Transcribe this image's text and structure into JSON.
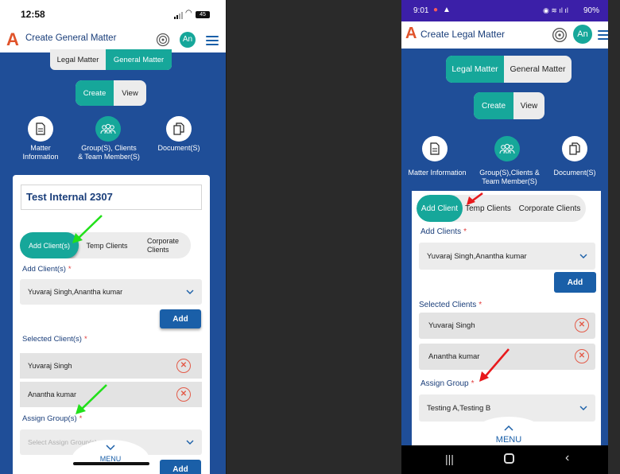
{
  "left": {
    "status": {
      "time": "12:58",
      "battery": "45"
    },
    "header": {
      "title": "Create General Matter",
      "avatar": "An"
    },
    "matter_tabs": [
      {
        "label": "Legal Matter",
        "active": false
      },
      {
        "label": "General Matter",
        "active": true
      }
    ],
    "mode_tabs": [
      {
        "label": "Create",
        "active": true
      },
      {
        "label": "View",
        "active": false
      }
    ],
    "steps": [
      {
        "label": "Matter\nInformation",
        "icon": "document-icon"
      },
      {
        "label": "Group(S), Clients\n& Team Member(S)",
        "icon": "group-icon"
      },
      {
        "label": "Document(S)",
        "icon": "copy-icon"
      }
    ],
    "matter_name": "Test Internal 2307",
    "client_tabs": [
      {
        "label": "Add Client(s)",
        "active": true
      },
      {
        "label": "Temp Clients",
        "active": false
      },
      {
        "label": "Corporate\nClients",
        "active": false
      }
    ],
    "add_clients_label": "Add Client(s)",
    "add_clients_value": "Yuvaraj Singh,Anantha kumar",
    "add_button": "Add",
    "selected_label": "Selected Client(s)",
    "selected_clients": [
      "Yuvaraj Singh",
      "Anantha kumar"
    ],
    "assign_label": "Assign Group(s)",
    "assign_placeholder": "Select Assign Group(s)",
    "add_button_2": "Add",
    "menu_label": "MENU",
    "required_star": "*"
  },
  "right": {
    "status": {
      "time": "9:01",
      "battery": "90%"
    },
    "header": {
      "title": "Create Legal Matter",
      "avatar": "An"
    },
    "matter_tabs": [
      {
        "label": "Legal Matter",
        "active": true
      },
      {
        "label": "General Matter",
        "active": false
      }
    ],
    "mode_tabs": [
      {
        "label": "Create",
        "active": true
      },
      {
        "label": "View",
        "active": false
      }
    ],
    "steps": [
      {
        "label": "Matter Information",
        "icon": "document-icon"
      },
      {
        "label": "Group(S),Clients &\nTeam Member(S)",
        "icon": "group-icon"
      },
      {
        "label": "Document(S)",
        "icon": "copy-icon"
      }
    ],
    "client_tabs": [
      {
        "label": "Add Client",
        "active": true
      },
      {
        "label": "Temp Clients",
        "active": false
      },
      {
        "label": "Corporate Clients",
        "active": false
      }
    ],
    "add_clients_label": "Add Clients",
    "add_clients_value": "Yuvaraj Singh,Anantha kumar",
    "add_button": "Add",
    "selected_label": "Selected Clients",
    "selected_clients": [
      "Yuvaraj Singh",
      "Anantha kumar"
    ],
    "assign_label": "Assign Group",
    "assign_value": "Testing A,Testing B",
    "menu_label": "MENU",
    "required_star": "*"
  },
  "colors": {
    "brand_blue": "#1f4e98",
    "teal": "#16a79a",
    "button_blue": "#1a5fa8",
    "remove_red": "#e35b49",
    "annotation_green": "#22e01a",
    "annotation_red": "#e8191c"
  }
}
